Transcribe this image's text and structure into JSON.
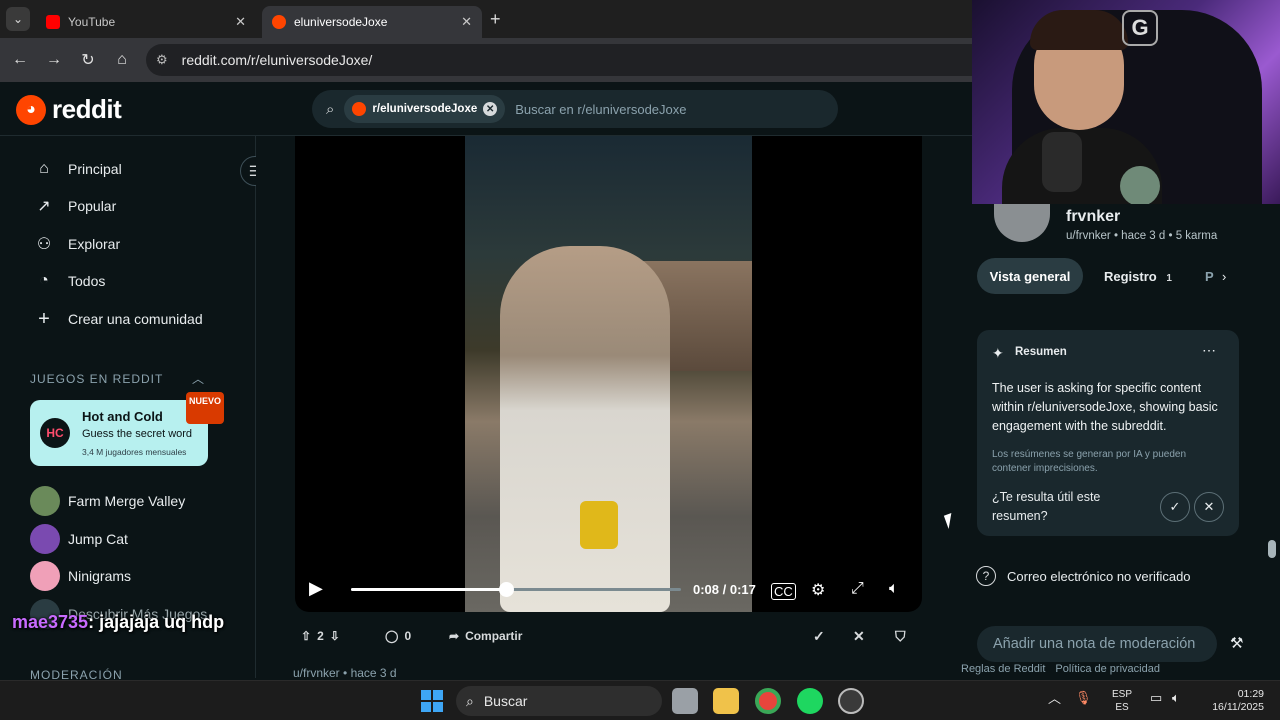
{
  "browser": {
    "tabs": [
      {
        "label": "YouTube",
        "active": false,
        "favicon_color": "#ff0000"
      },
      {
        "label": "eluniversodeJoxe",
        "active": true,
        "favicon_color": "#ff4500"
      }
    ],
    "url": "reddit.com/r/eluniversodeJoxe/"
  },
  "reddit": {
    "logo_text": "reddit",
    "search": {
      "chip": "r/eluniversodeJoxe",
      "placeholder": "Buscar en r/eluniversodeJoxe"
    }
  },
  "sidebar": {
    "nav": [
      {
        "label": "Principal",
        "icon": "home-icon",
        "glyph": "⌂"
      },
      {
        "label": "Popular",
        "icon": "popular-icon",
        "glyph": "↗"
      },
      {
        "label": "Explorar",
        "icon": "explore-icon",
        "glyph": "⚇"
      },
      {
        "label": "Todos",
        "icon": "all-icon",
        "glyph": "◔"
      },
      {
        "label": "Crear una comunidad",
        "icon": "plus-icon",
        "glyph": "+"
      }
    ],
    "games_section": "JUEGOS EN REDDIT",
    "featured_game": {
      "title": "Hot and Cold",
      "subtitle": "Guess the secret word",
      "players": "3,4 M jugadores mensuales",
      "badge": "NUEVO"
    },
    "games": [
      {
        "label": "Farm Merge Valley",
        "color": "#6a8a5a"
      },
      {
        "label": "Jump Cat",
        "color": "#7a4ab0"
      },
      {
        "label": "Ninigrams",
        "color": "#f0a0b8"
      },
      {
        "label": "Descubrir Más Juegos",
        "color": "#2a3c42"
      }
    ],
    "mod_section": "MODERACIÓN"
  },
  "chat_overlay": {
    "user": "mae3735",
    "message": ": jajajaja uq hdp"
  },
  "video": {
    "time": "0:08 / 0:17",
    "progress": 0.4706
  },
  "post_actions": {
    "votes": "2",
    "comments": "0",
    "share": "Compartir"
  },
  "next_post": {
    "author": "u/frvnker",
    "time": "hace 3 d"
  },
  "profile": {
    "name": "frvnker",
    "handle": "u/frvnker",
    "age": "hace 3 d",
    "karma": "5 karma",
    "tabs": {
      "overview": "Vista general",
      "log": "Registro",
      "log_count": "1",
      "more": "P"
    }
  },
  "summary": {
    "title": "Resumen",
    "body": "The user is asking for specific content within r/eluniversodeJoxe, showing basic engagement with the subreddit.",
    "note": "Los resúmenes se generan por IA y pueden contener imprecisiones.",
    "question": "¿Te resulta útil este resumen?"
  },
  "email_status": "Correo electrónico no verificado",
  "mod_note_placeholder": "Añadir una nota de moderación",
  "footer_links": [
    "Reglas de Reddit",
    "Política de privacidad"
  ],
  "taskbar": {
    "search": "Buscar",
    "lang_top": "ESP",
    "lang_bottom": "ES",
    "time": "01:29",
    "date": "16/11/2025"
  }
}
